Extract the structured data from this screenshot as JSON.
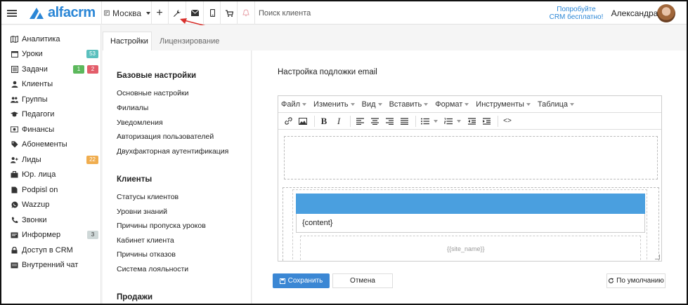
{
  "app": {
    "logo_text": "alfacrm",
    "brand_color": "#2a86d6"
  },
  "topbar": {
    "branch": "Москва",
    "search_placeholder": "Поиск клиента",
    "promo_line1": "Попробуйте",
    "promo_line2": "CRM бесплатно!",
    "user_name": "Александра"
  },
  "sidebar": {
    "items": [
      {
        "label": "Аналитика",
        "icon": "map-icon"
      },
      {
        "label": "Уроки",
        "icon": "calendar-icon",
        "badges": [
          {
            "text": "53",
            "color": "#5bc0be"
          }
        ]
      },
      {
        "label": "Задачи",
        "icon": "tasks-icon",
        "badges": [
          {
            "text": "1",
            "color": "#5cb85c"
          },
          {
            "text": "2",
            "color": "#e35d6a"
          }
        ]
      },
      {
        "label": "Клиенты",
        "icon": "user-icon"
      },
      {
        "label": "Группы",
        "icon": "users-icon"
      },
      {
        "label": "Педагоги",
        "icon": "graduation-cap-icon"
      },
      {
        "label": "Финансы",
        "icon": "money-icon"
      },
      {
        "label": "Абонементы",
        "icon": "tag-icon"
      },
      {
        "label": "Лиды",
        "icon": "user-plus-icon",
        "badges": [
          {
            "text": "22",
            "color": "#f0ad4e"
          }
        ]
      },
      {
        "label": "Юр. лица",
        "icon": "briefcase-icon"
      },
      {
        "label": "Podpisl on",
        "icon": "file-icon"
      },
      {
        "label": "Wazzup",
        "icon": "whatsapp-icon"
      },
      {
        "label": "Звонки",
        "icon": "phone-icon"
      },
      {
        "label": "Информер",
        "icon": "info-icon",
        "badges": [
          {
            "text": "3",
            "color": "#cfd8d8"
          }
        ]
      },
      {
        "label": "Доступ в CRM",
        "icon": "lock-icon"
      },
      {
        "label": "Внутренний чат",
        "icon": "chat-icon"
      }
    ]
  },
  "tabs": [
    {
      "label": "Настройки",
      "active": true
    },
    {
      "label": "Лицензирование",
      "active": false
    }
  ],
  "settings_menu": {
    "sections": [
      {
        "title": "Базовые настройки",
        "items": [
          "Основные настройки",
          "Филиалы",
          "Уведомления",
          "Авторизация пользователей",
          "Двухфакторная аутентификация"
        ]
      },
      {
        "title": "Клиенты",
        "items": [
          "Статусы клиентов",
          "Уровни знаний",
          "Причины пропуска уроков",
          "Кабинет клиента",
          "Причины отказов",
          "Система лояльности"
        ]
      },
      {
        "title": "Продажи",
        "items": []
      }
    ]
  },
  "content": {
    "title": "Настройка подложки email",
    "editor": {
      "menu": [
        "Файл",
        "Изменить",
        "Вид",
        "Вставить",
        "Формат",
        "Инструменты",
        "Таблица"
      ],
      "body_placeholder": "{content}",
      "footer_var": "{{site_name}}",
      "header_color": "#4a9fdf"
    },
    "buttons": {
      "save": "Сохранить",
      "cancel": "Отмена",
      "default": "По умолчанию"
    }
  }
}
